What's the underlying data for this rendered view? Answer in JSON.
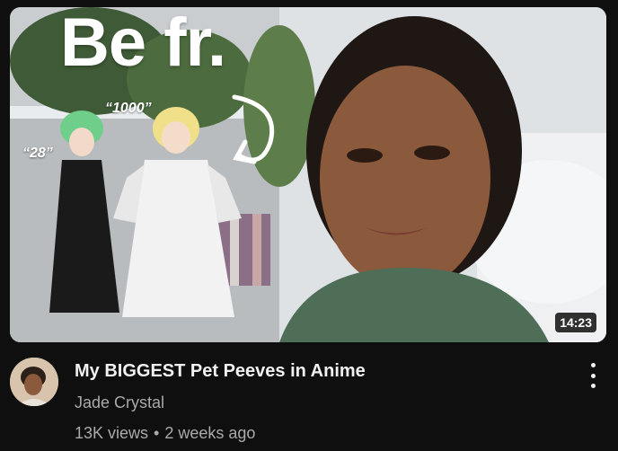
{
  "video": {
    "title": "My BIGGEST Pet Peeves in Anime",
    "channel": "Jade Crystal",
    "views": "13K views",
    "separator": "•",
    "age": "2 weeks ago",
    "duration": "14:23"
  },
  "thumbnail": {
    "overlay_text": "Be fr.",
    "label_left": "“28”",
    "label_right": "“1000”"
  },
  "icons": {
    "more": "vertical-ellipsis-icon"
  },
  "colors": {
    "background": "#0f0f0f",
    "title_text": "#f1f1f1",
    "secondary_text": "#aaaaaa",
    "duration_badge_bg": "#000000"
  }
}
